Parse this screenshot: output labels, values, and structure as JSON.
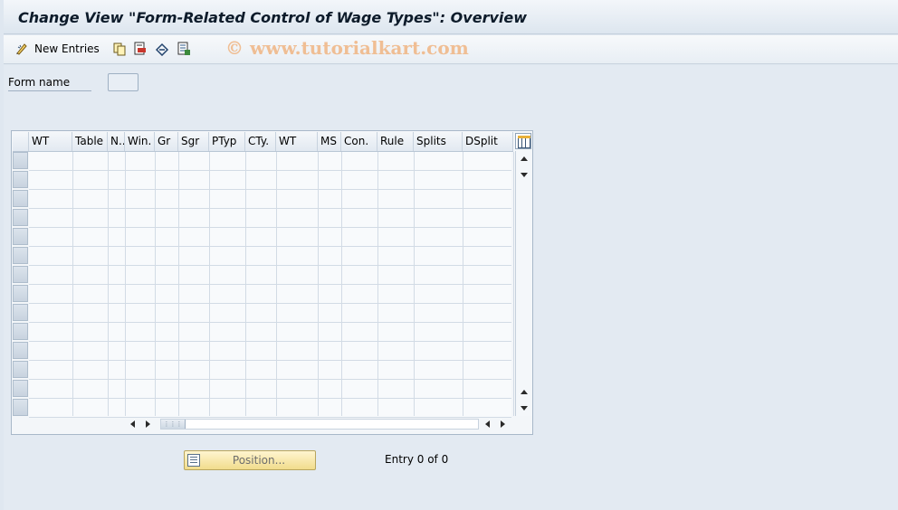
{
  "window": {
    "title": "Change View \"Form-Related Control of Wage Types\": Overview"
  },
  "toolbar": {
    "new_entries_label": "New Entries",
    "watermark": "© www.tutorialkart.com",
    "icons": [
      "new-entries-icon",
      "copy-icon",
      "delete-icon",
      "undo-icon",
      "select-all-icon"
    ]
  },
  "form": {
    "form_name_label": "Form name",
    "form_name_value": ""
  },
  "table": {
    "columns": [
      "WT",
      "Table",
      "N..",
      "Win.",
      "Gr",
      "Sgr",
      "PTyp",
      "CTy.",
      "WT",
      "MS",
      "Con.",
      "Rule",
      "Splits",
      "DSplit"
    ],
    "visible_rows": 14
  },
  "footer": {
    "position_button_label": "Position...",
    "entry_text": "Entry 0 of 0"
  },
  "colors": {
    "title_text": "#0d1b2a",
    "watermark": "#f0b98a",
    "position_button": "#f1dc8c"
  }
}
